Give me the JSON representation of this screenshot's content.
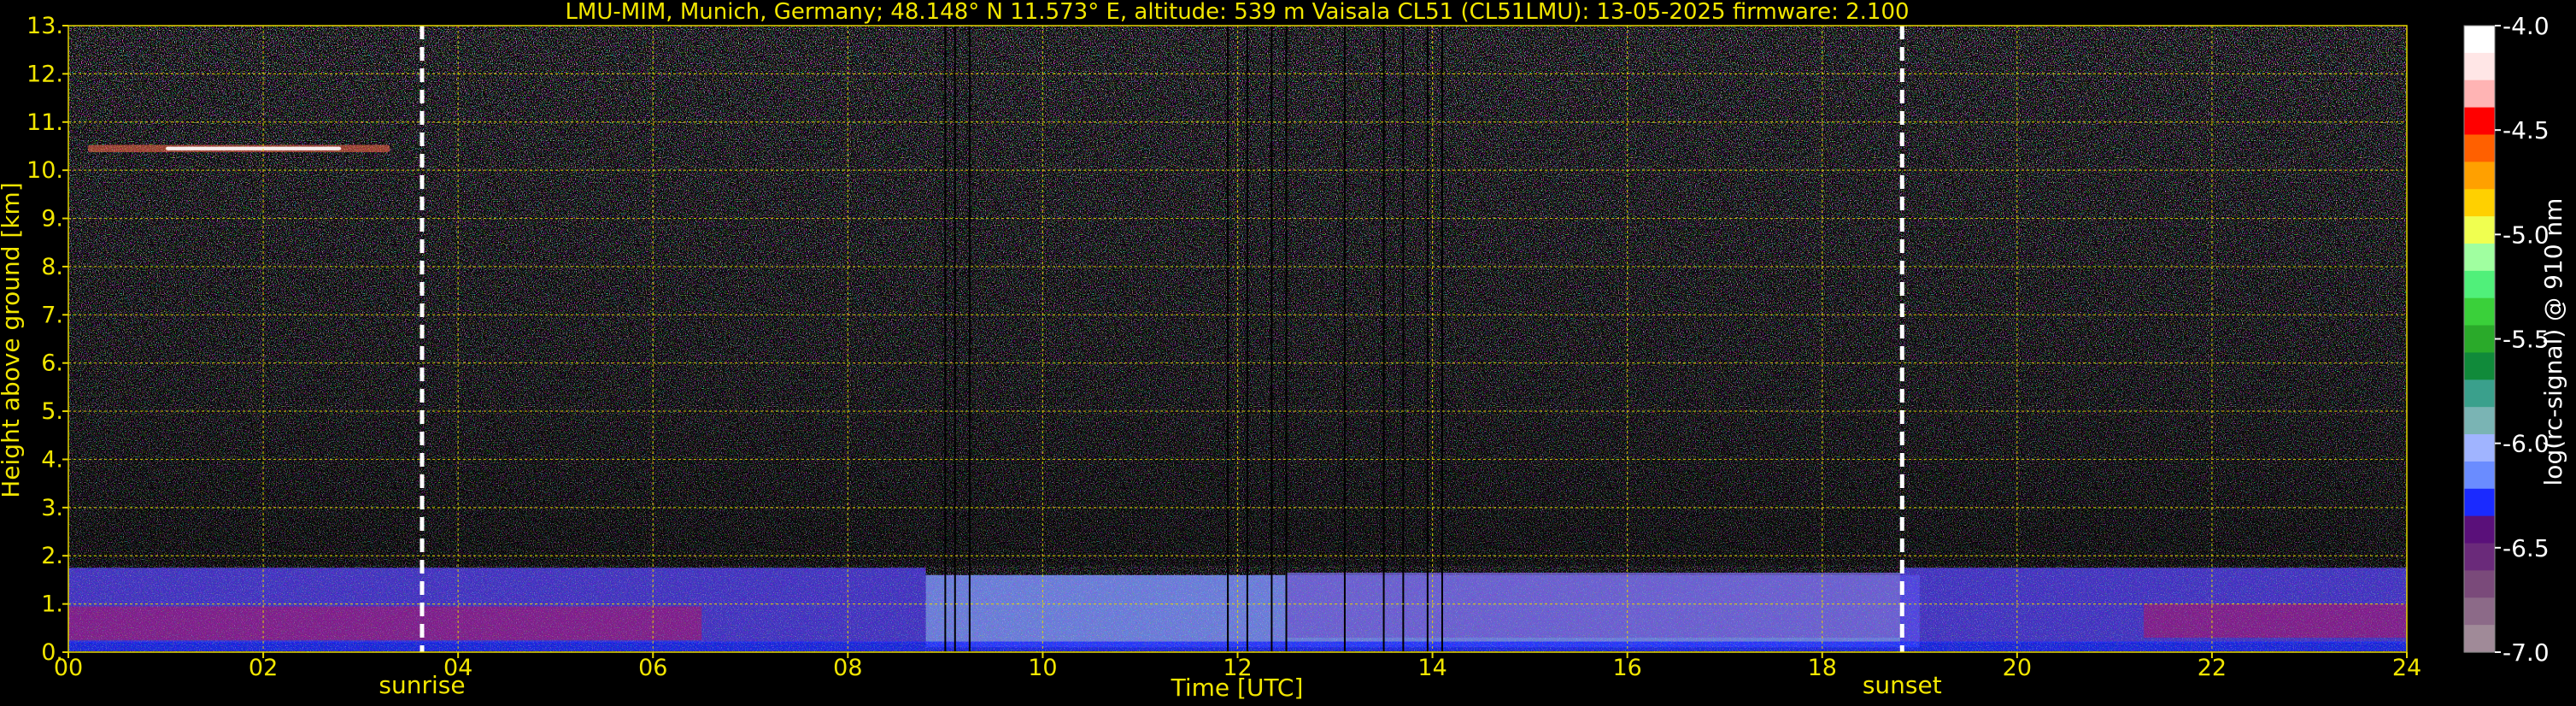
{
  "chart_data": {
    "type": "heatmap",
    "title": "LMU-MIM, Munich, Germany; 48.148° N 11.573° E, altitude: 539 m    Vaisala CL51 (CL51LMU): 13-05-2025    firmware: 2.100",
    "xlabel": "Time [UTC]",
    "ylabel": "Height above ground [km]",
    "xlim": [
      0,
      24
    ],
    "ylim": [
      0,
      13
    ],
    "x_ticks": [
      "00",
      "02",
      "04",
      "06",
      "08",
      "10",
      "12",
      "14",
      "16",
      "18",
      "20",
      "22",
      "24"
    ],
    "x_tick_values": [
      0,
      2,
      4,
      6,
      8,
      10,
      12,
      14,
      16,
      18,
      20,
      22,
      24
    ],
    "y_ticks": [
      "0.",
      "1.",
      "2.",
      "3.",
      "4.",
      "5.",
      "6.",
      "7.",
      "8.",
      "9.",
      "10.",
      "11.",
      "12.",
      "13."
    ],
    "y_tick_values": [
      0,
      1,
      2,
      3,
      4,
      5,
      6,
      7,
      8,
      9,
      10,
      11,
      12,
      13
    ],
    "grid": true,
    "grid_color": "#e6d600",
    "text_color": "#f2e600",
    "events": [
      {
        "label": "sunrise",
        "time": 3.63
      },
      {
        "label": "sunset",
        "time": 18.82
      }
    ],
    "colorbar": {
      "label": "log(rc-signal) @ 910 nm",
      "range": [
        -7.0,
        -4.0
      ],
      "ticks": [
        "-4.0",
        "-4.5",
        "-5.0",
        "-5.5",
        "-6.0",
        "-6.5",
        "-7.0"
      ],
      "tick_values": [
        -4.0,
        -4.5,
        -5.0,
        -5.5,
        -6.0,
        -6.5,
        -7.0
      ],
      "colors": [
        "#a08a98",
        "#8c6a88",
        "#7a4a7a",
        "#6a2a7a",
        "#5a107a",
        "#1a2aff",
        "#6a8cff",
        "#a0b4ff",
        "#7ab4b4",
        "#3aa08c",
        "#108a3a",
        "#2aaa2a",
        "#3ad03a",
        "#50f07a",
        "#a0ffa0",
        "#f0ff50",
        "#ffd000",
        "#ffa000",
        "#ff6000",
        "#ff0000",
        "#ffb4b4",
        "#ffe6e6",
        "#ffffff"
      ]
    },
    "layers": [
      {
        "t0": 0,
        "t1": 8.8,
        "h0": 0.2,
        "h1": 1.75,
        "color": "#4a3ae0"
      },
      {
        "t0": 0,
        "t1": 6.5,
        "h0": 0.25,
        "h1": 0.95,
        "color": "#8a1a80"
      },
      {
        "t0": 8.8,
        "t1": 19.0,
        "h0": 0.1,
        "h1": 1.6,
        "color": "#7a90ff"
      },
      {
        "t0": 12.5,
        "t1": 18.8,
        "h0": 0.3,
        "h1": 1.65,
        "color": "#6a5ad0"
      },
      {
        "t0": 18.8,
        "t1": 24,
        "h0": 0.2,
        "h1": 1.75,
        "color": "#4a3ae0"
      },
      {
        "t0": 21.3,
        "t1": 24,
        "h0": 0.3,
        "h1": 1.0,
        "color": "#8a1a80"
      },
      {
        "t0": 0,
        "t1": 24,
        "h0": 0.02,
        "h1": 0.22,
        "color": "#1a2aff"
      }
    ],
    "cirrus": {
      "t0": 0.2,
      "t1": 3.3,
      "h": 10.45,
      "thickness": 0.15
    },
    "dropouts": [
      9.0,
      9.1,
      9.25,
      11.9,
      12.1,
      12.35,
      12.5,
      13.1,
      13.5,
      13.7,
      13.95,
      14.1
    ]
  }
}
